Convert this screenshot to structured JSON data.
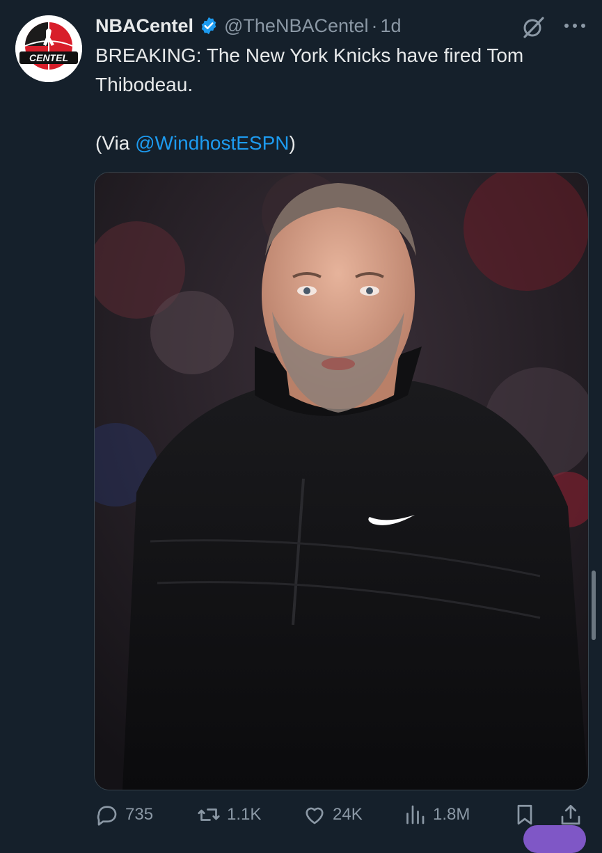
{
  "tweet": {
    "author": {
      "display_name": "NBACentel",
      "handle": "@TheNBACentel",
      "separator": "·",
      "timestamp": "1d",
      "verified": true,
      "avatar_text": "CENTEL"
    },
    "text": {
      "line1": "BREAKING: The New York Knicks have fired Tom Thibodeau.",
      "via_prefix": "(Via ",
      "mention": "@WindhostESPN",
      "via_suffix": ")"
    },
    "media": {
      "description_icon": "photo"
    },
    "actions": {
      "replies": "735",
      "retweets": "1.1K",
      "likes": "24K",
      "views": "1.8M"
    }
  },
  "colors": {
    "background": "#15202b",
    "text": "#e7e9ea",
    "muted": "#8b98a5",
    "accent": "#1d9bf0",
    "verified": "#1d9bf0"
  },
  "icons": {
    "reply": "speech-bubble-icon",
    "retweet": "retweet-arrows-icon",
    "like": "heart-icon",
    "views": "bar-chart-icon",
    "bookmark": "bookmark-icon",
    "share": "share-upload-icon",
    "grok": "grok-slash-icon",
    "more": "ellipsis-icon"
  }
}
